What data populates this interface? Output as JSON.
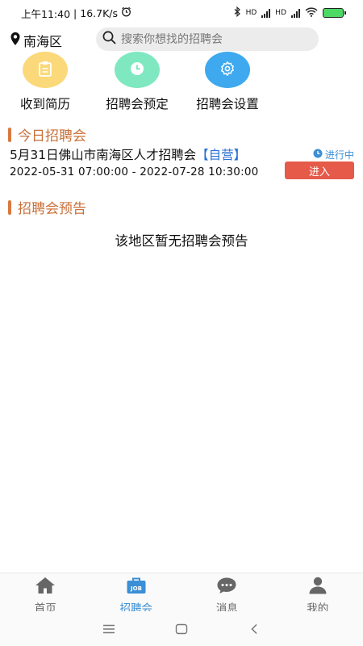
{
  "status_bar": {
    "time": "上午11:40",
    "separator": "|",
    "speed": "16.7K/s",
    "signal1_label": "HD",
    "signal2_label": "HD"
  },
  "top_bar": {
    "location": "南海区",
    "search_placeholder": "搜索你想找的招聘会"
  },
  "actions": [
    {
      "label": "收到简历",
      "color": "#fbd97a",
      "icon": "clipboard-icon"
    },
    {
      "label": "招聘会预定",
      "color": "#7fe8c0",
      "icon": "clock-icon"
    },
    {
      "label": "招聘会设置",
      "color": "#3ea9ee",
      "icon": "gear-icon"
    }
  ],
  "today_section": {
    "title": "今日招聘会",
    "fairs": [
      {
        "name": "5月31日佛山市南海区人才招聘会",
        "tag": "【自营】",
        "status": "进行中",
        "time": "2022-05-31 07:00:00 - 2022-07-28 10:30:00",
        "enter_label": "进入"
      }
    ]
  },
  "preview_section": {
    "title": "招聘会预告",
    "empty_message": "该地区暂无招聘会预告"
  },
  "bottom_nav": [
    {
      "label": "首页",
      "icon": "home-icon",
      "active": false
    },
    {
      "label": "招聘会",
      "icon": "job-fair-icon",
      "active": true,
      "icon_text": "JOB"
    },
    {
      "label": "消息",
      "icon": "message-icon",
      "active": false
    },
    {
      "label": "我的",
      "icon": "user-icon",
      "active": false
    }
  ],
  "colors": {
    "accent": "#3a8fd6",
    "section_title": "#c9703a",
    "enter_button": "#e55a49"
  }
}
